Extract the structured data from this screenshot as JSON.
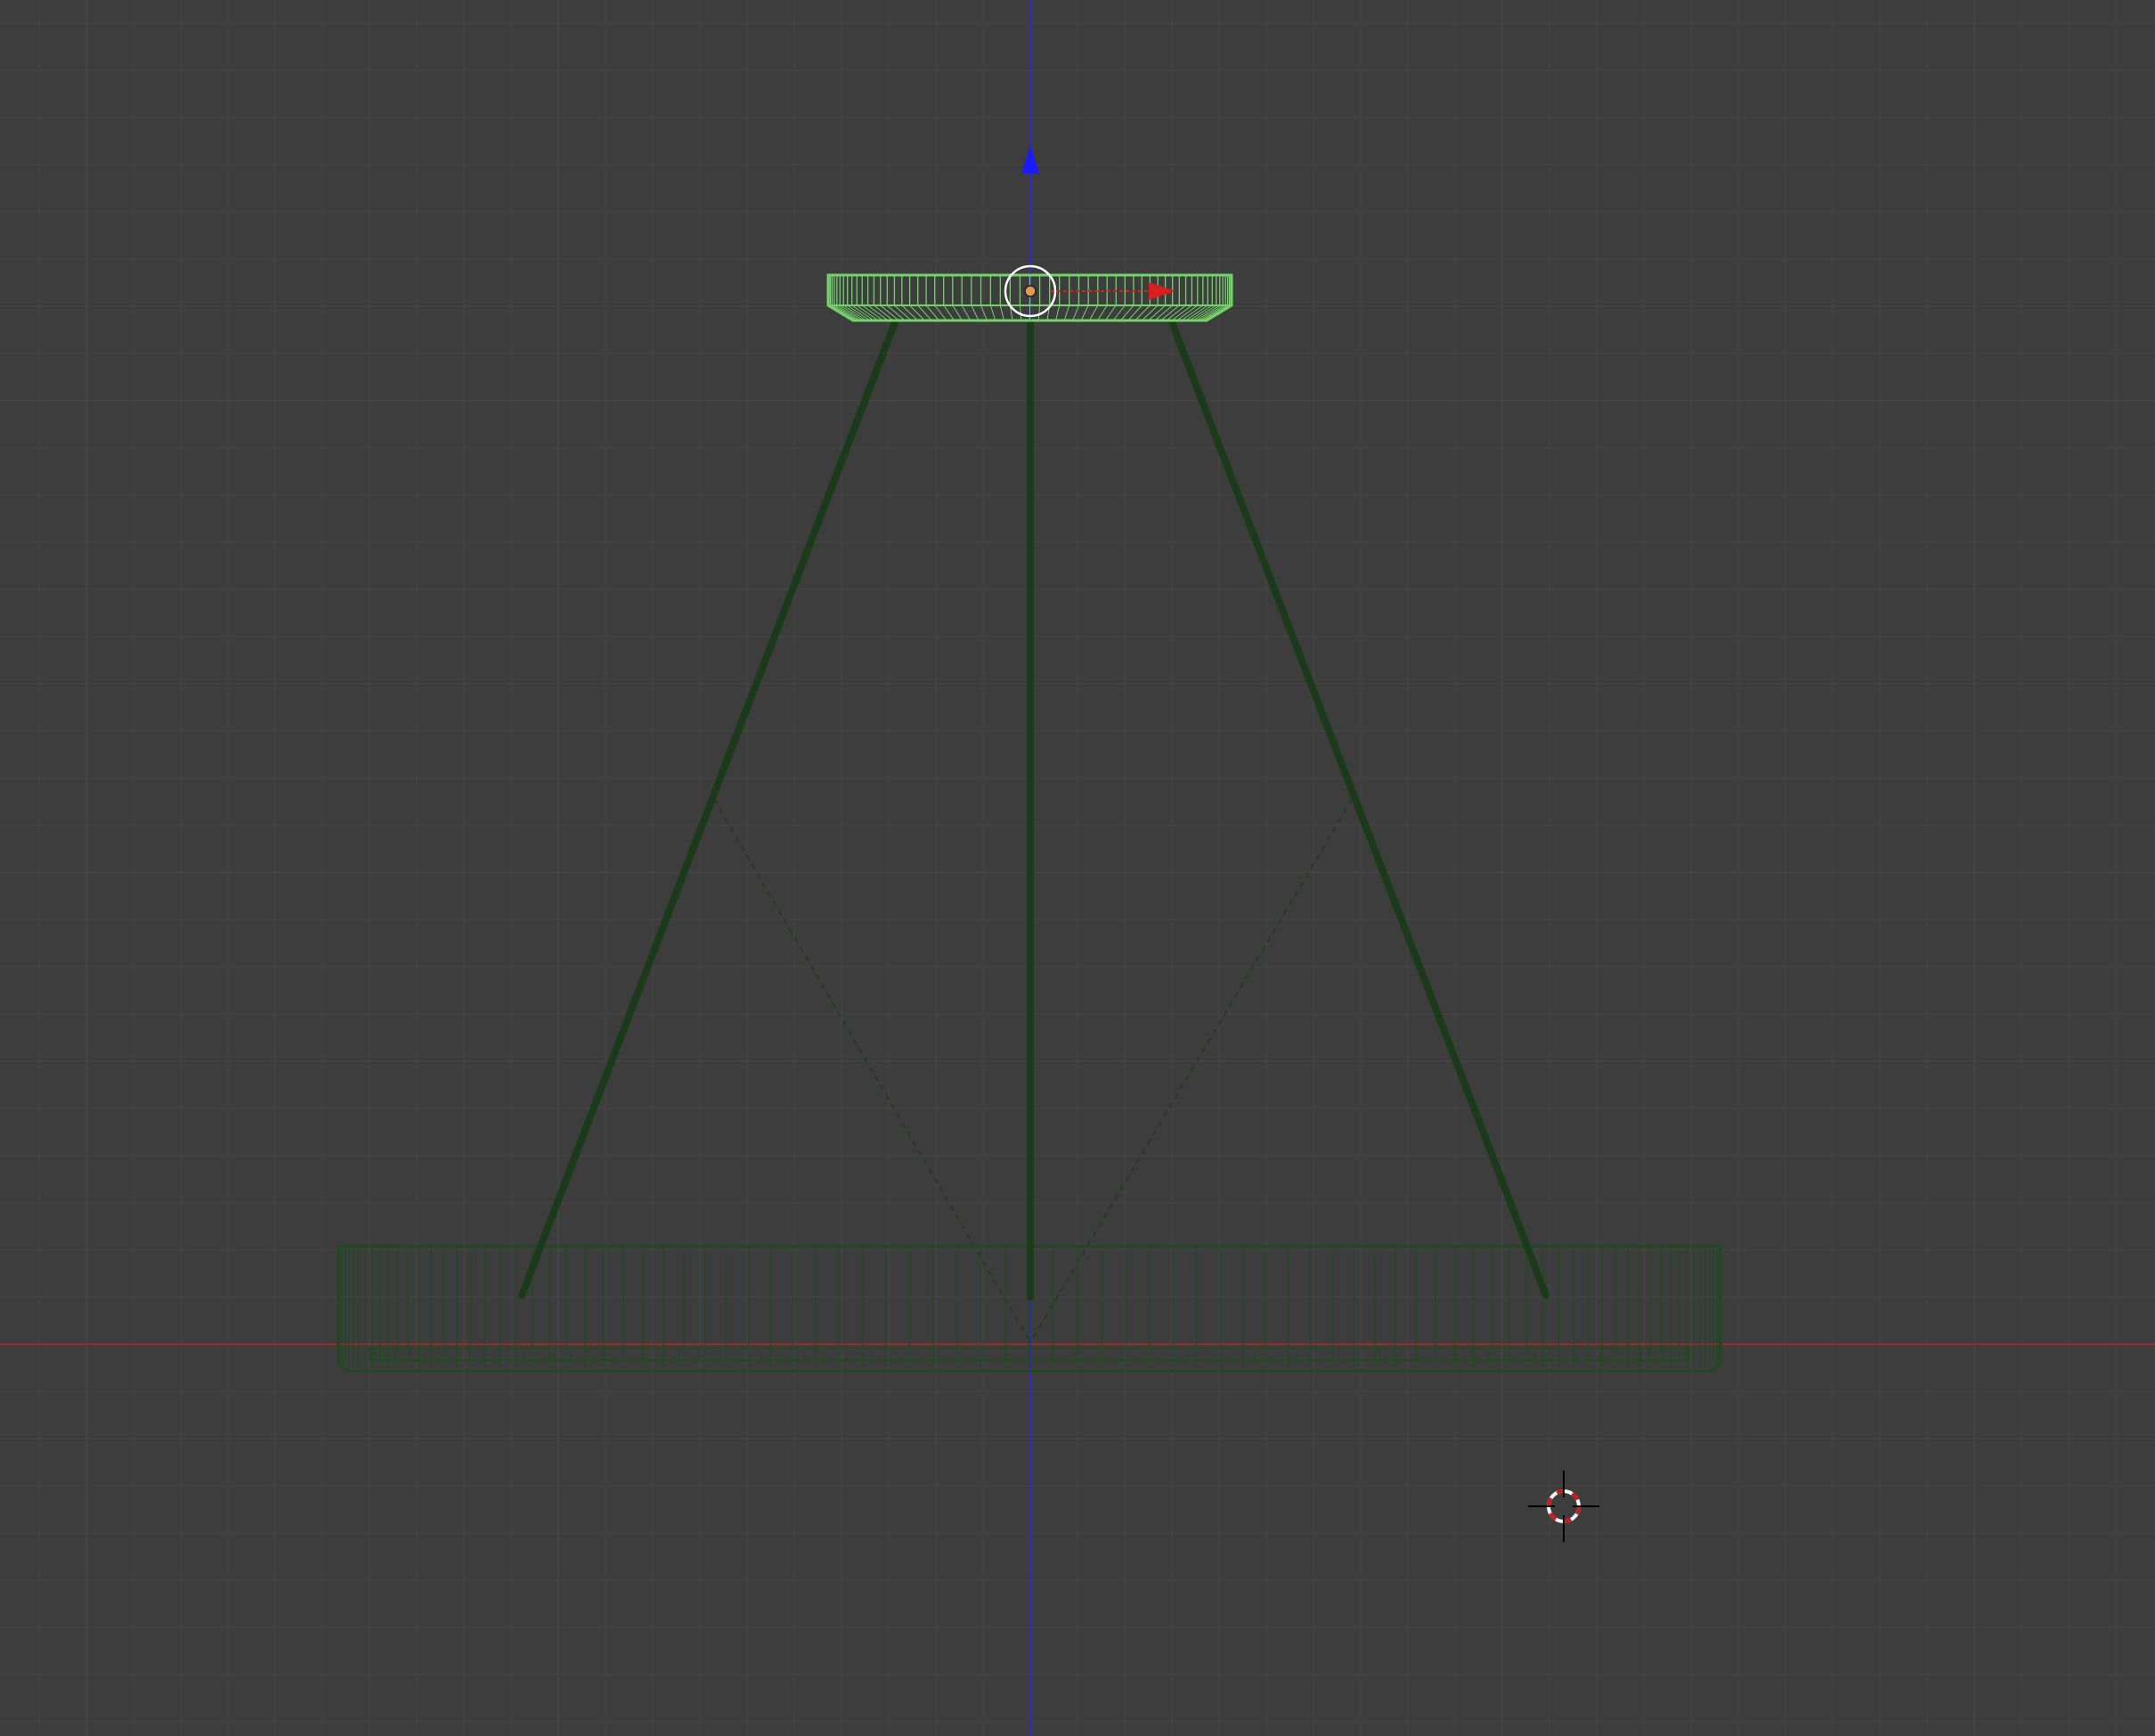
{
  "viewport": {
    "background_color": "#3d3d3d",
    "grid_minor_color": "#454545",
    "grid_major_color": "#4a4a4a"
  },
  "axes": {
    "x_axis_color": "#9a2b2b",
    "z_axis_color": "#2a2ad0"
  },
  "object": {
    "selected_color": "#73d36a",
    "unselected_color": "#1f4a1f",
    "wire_color": "#1a3a1a"
  },
  "gizmo": {
    "z_arrow_color": "#1a1aff",
    "x_arrow_color": "#d81e1e",
    "pivot_color": "#e69a50",
    "ring_color": "#ffffff"
  },
  "cursor3d": {
    "ring_red": "#d01a1a",
    "ring_white": "#ffffff",
    "crosshair_color": "#000000"
  }
}
